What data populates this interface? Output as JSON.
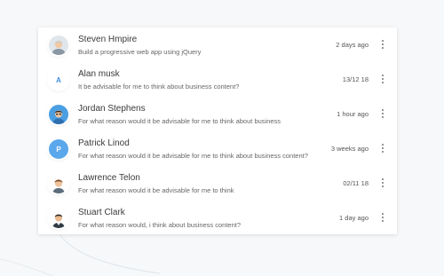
{
  "conversations": [
    {
      "name": "Steven Hmpire",
      "message": "Build a progressive web app using jQuery",
      "time": "2 days ago",
      "avatar": {
        "type": "image",
        "icon": "user-avatar-grey-shirt"
      }
    },
    {
      "name": "Alan musk",
      "message": "It be advisable for me to think about business content?",
      "time": "13/12 18",
      "avatar": {
        "type": "letter",
        "letter": "A",
        "style": "plain"
      }
    },
    {
      "name": "Jordan Stephens",
      "message": "For what reason would it be advisable for me to think about business",
      "time": "1 hour ago",
      "avatar": {
        "type": "image",
        "icon": "user-avatar-blue"
      }
    },
    {
      "name": "Patrick Linod",
      "message": "For what reason would it be advisable for me to think about business content?",
      "time": "3 weeks ago",
      "avatar": {
        "type": "letter",
        "letter": "P",
        "style": "filled"
      }
    },
    {
      "name": "Lawrence Telon",
      "message": "For what reason would it be advisable for me to think",
      "time": "02/11 18",
      "avatar": {
        "type": "image",
        "icon": "user-avatar-brown-hair"
      }
    },
    {
      "name": "Stuart Clark",
      "message": "For what reason would, i think about business content?",
      "time": "1 day ago",
      "avatar": {
        "type": "image",
        "icon": "user-avatar-dark-hair"
      }
    }
  ],
  "colors": {
    "accent": "#3f8fe0",
    "filled_avatar": "#5aa7ec",
    "background": "#f7f8f9"
  }
}
